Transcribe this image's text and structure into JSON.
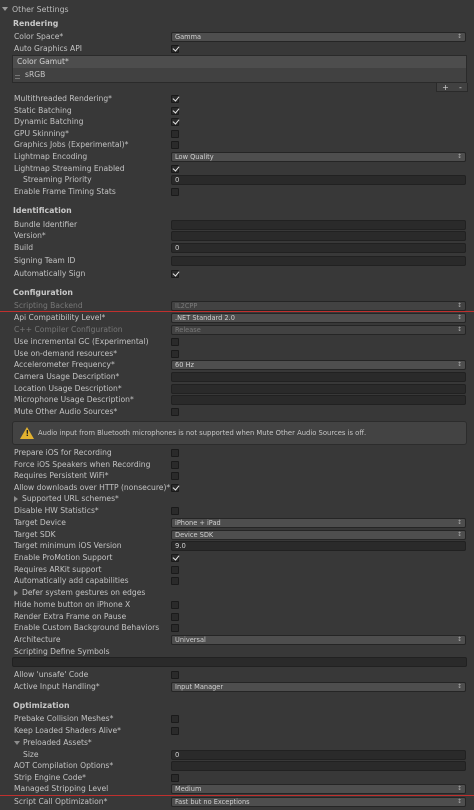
{
  "section_title": "Other Settings",
  "rendering": {
    "header": "Rendering",
    "color_space": {
      "label": "Color Space*",
      "value": "Gamma"
    },
    "auto_graphics_api": {
      "label": "Auto Graphics API",
      "checked": true
    },
    "color_gamut": {
      "header": "Color Gamut*",
      "items": [
        "sRGB"
      ],
      "add_label": "+",
      "remove_label": "-"
    },
    "multithreaded": {
      "label": "Multithreaded Rendering*",
      "checked": true
    },
    "static_batching": {
      "label": "Static Batching",
      "checked": true
    },
    "dynamic_batching": {
      "label": "Dynamic Batching",
      "checked": true
    },
    "gpu_skinning": {
      "label": "GPU Skinning*",
      "checked": false
    },
    "graphics_jobs": {
      "label": "Graphics Jobs (Experimental)*",
      "checked": false
    },
    "lightmap_encoding": {
      "label": "Lightmap Encoding",
      "value": "Low Quality"
    },
    "lightmap_streaming": {
      "label": "Lightmap Streaming Enabled",
      "checked": true
    },
    "streaming_priority": {
      "label": "Streaming Priority",
      "value": "0"
    },
    "frame_timing": {
      "label": "Enable Frame Timing Stats",
      "checked": false
    }
  },
  "identification": {
    "header": "Identification",
    "bundle_id": {
      "label": "Bundle Identifier",
      "value": ""
    },
    "version": {
      "label": "Version*",
      "value": ""
    },
    "build": {
      "label": "Build",
      "value": "0"
    },
    "signing_team": {
      "label": "Signing Team ID",
      "value": ""
    },
    "auto_sign": {
      "label": "Automatically Sign",
      "checked": true
    }
  },
  "configuration": {
    "header": "Configuration",
    "scripting_backend": {
      "label": "Scripting Backend",
      "value": "IL2CPP"
    },
    "api_compat": {
      "label": "Api Compatibility Level*",
      "value": ".NET Standard 2.0"
    },
    "cpp_config": {
      "label": "C++ Compiler Configuration",
      "value": "Release"
    },
    "incremental_gc": {
      "label": "Use incremental GC (Experimental)",
      "checked": false
    },
    "on_demand": {
      "label": "Use on-demand resources*",
      "checked": false
    },
    "accel_freq": {
      "label": "Accelerometer Frequency*",
      "value": "60 Hz"
    },
    "camera_usage": {
      "label": "Camera Usage Description*",
      "value": ""
    },
    "location_usage": {
      "label": "Location Usage Description*",
      "value": ""
    },
    "mic_usage": {
      "label": "Microphone Usage Description*",
      "value": ""
    },
    "mute_audio": {
      "label": "Mute Other Audio Sources*",
      "checked": false
    },
    "warning": "Audio input from Bluetooth microphones is not supported when Mute Other Audio Sources is off.",
    "prepare_ios_recording": {
      "label": "Prepare iOS for Recording",
      "checked": false
    },
    "force_speakers": {
      "label": "Force iOS Speakers when Recording",
      "checked": false
    },
    "persistent_wifi": {
      "label": "Requires Persistent WiFi*",
      "checked": false
    },
    "allow_http": {
      "label": "Allow downloads over HTTP (nonsecure)*",
      "checked": true
    },
    "url_schemes": {
      "label": "Supported URL schemes*"
    },
    "disable_hw_stats": {
      "label": "Disable HW Statistics*",
      "checked": false
    },
    "target_device": {
      "label": "Target Device",
      "value": "iPhone + iPad"
    },
    "target_sdk": {
      "label": "Target SDK",
      "value": "Device SDK"
    },
    "target_min_ios": {
      "label": "Target minimum iOS Version",
      "value": "9.0"
    },
    "promotion": {
      "label": "Enable ProMotion Support",
      "checked": true
    },
    "arkit": {
      "label": "Requires ARKit support",
      "checked": false
    },
    "auto_caps": {
      "label": "Automatically add capabilities",
      "checked": false
    },
    "defer_gestures": {
      "label": "Defer system gestures on edges"
    },
    "hide_home": {
      "label": "Hide home button on iPhone X",
      "checked": false
    },
    "extra_frame": {
      "label": "Render Extra Frame on Pause",
      "checked": false
    },
    "custom_bg": {
      "label": "Enable Custom Background Behaviors",
      "checked": false
    },
    "architecture": {
      "label": "Architecture",
      "value": "Universal"
    },
    "define_symbols": {
      "label": "Scripting Define Symbols",
      "value": ""
    },
    "allow_unsafe": {
      "label": "Allow 'unsafe' Code",
      "checked": false
    },
    "input_handling": {
      "label": "Active Input Handling*",
      "value": "Input Manager"
    }
  },
  "optimization": {
    "header": "Optimization",
    "prebake": {
      "label": "Prebake Collision Meshes*",
      "checked": false
    },
    "keep_shaders": {
      "label": "Keep Loaded Shaders Alive*",
      "checked": false
    },
    "preloaded_assets": {
      "label": "Preloaded Assets*"
    },
    "size": {
      "label": "Size",
      "value": "0"
    },
    "aot_options": {
      "label": "AOT Compilation Options*",
      "value": ""
    },
    "strip_engine": {
      "label": "Strip Engine Code*",
      "checked": false
    },
    "managed_stripping": {
      "label": "Managed Stripping Level",
      "value": "Medium"
    },
    "script_call_opt": {
      "label": "Script Call Optimization*",
      "value": "Fast but no Exceptions"
    }
  },
  "colors": {
    "highlight_line": "#c0302e",
    "warning_icon": "#e2b12f",
    "background": "#383838"
  }
}
